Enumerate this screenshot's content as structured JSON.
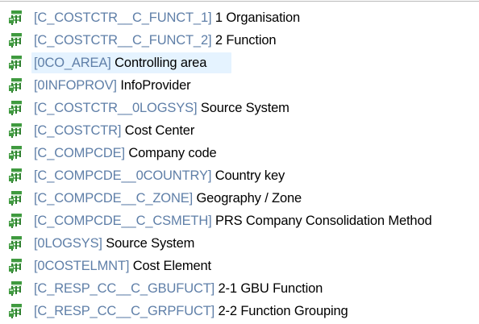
{
  "tree": {
    "items": [
      {
        "tech": "[C_COSTCTR__C_FUNCT_1]",
        "desc": "1 Organisation",
        "icon": "characteristic-icon",
        "selected": false
      },
      {
        "tech": "[C_COSTCTR__C_FUNCT_2]",
        "desc": "2 Function",
        "icon": "characteristic-icon",
        "selected": false
      },
      {
        "tech": "[0CO_AREA]",
        "desc": "Controlling area",
        "icon": "characteristic-icon",
        "selected": true
      },
      {
        "tech": "[0INFOPROV]",
        "desc": "InfoProvider",
        "icon": "characteristic-icon",
        "selected": false
      },
      {
        "tech": "[C_COSTCTR__0LOGSYS]",
        "desc": "Source System",
        "icon": "characteristic-icon",
        "selected": false
      },
      {
        "tech": "[C_COSTCTR]",
        "desc": "Cost Center",
        "icon": "characteristic-icon",
        "selected": false
      },
      {
        "tech": "[C_COMPCDE]",
        "desc": "Company code",
        "icon": "characteristic-icon",
        "selected": false
      },
      {
        "tech": "[C_COMPCDE__0COUNTRY]",
        "desc": "Country key",
        "icon": "characteristic-icon",
        "selected": false
      },
      {
        "tech": "[C_COMPCDE__C_ZONE]",
        "desc": "Geography / Zone",
        "icon": "characteristic-icon",
        "selected": false
      },
      {
        "tech": "[C_COMPCDE__C_CSMETH]",
        "desc": "PRS Company Consolidation Method",
        "icon": "characteristic-icon",
        "selected": false
      },
      {
        "tech": "[0LOGSYS]",
        "desc": "Source System",
        "icon": "characteristic-icon",
        "selected": false
      },
      {
        "tech": "[0COSTELMNT]",
        "desc": "Cost Element",
        "icon": "characteristic-icon",
        "selected": false
      },
      {
        "tech": "[C_RESP_CC__C_GBUFUCT]",
        "desc": "2-1 GBU Function",
        "icon": "characteristic-icon",
        "selected": false
      },
      {
        "tech": "[C_RESP_CC__C_GRPFUCT]",
        "desc": "2-2 Function Grouping",
        "icon": "characteristic-icon",
        "selected": false
      }
    ]
  },
  "colors": {
    "tech_text": "#5f7fa8",
    "desc_text": "#000000",
    "selection": "#e5f3ff",
    "icon_green": "#3f9a3f"
  }
}
